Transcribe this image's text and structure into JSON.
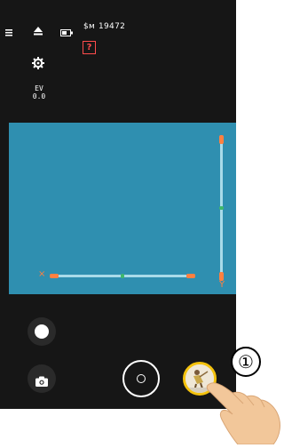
{
  "status_bar": {
    "menu_icon": "menu-icon",
    "eject_icon": "eject-icon",
    "battery_icon": "battery-icon",
    "storage_prefix": "$м",
    "storage_count": "19472",
    "warning_label": "?"
  },
  "settings": {
    "gear_icon": "gear-icon",
    "ev_label": "EV",
    "ev_value": "0.0"
  },
  "level": {
    "horizontal_marker": "×",
    "vertical_marker": "Y"
  },
  "controls": {
    "video_icon": "record-icon",
    "photo_icon": "camera-icon",
    "shutter_icon": "shutter-icon",
    "gallery_icon": "gallery-thumbnail"
  },
  "annotation": {
    "callout_label": "①",
    "hand_icon": "pointing-hand-icon"
  },
  "colors": {
    "viewfinder": "#2f8fb0",
    "level_bar": "#a9dbe9",
    "level_end": "#ff8040",
    "level_center": "#3fb96b",
    "warning": "#ff4c4c",
    "thumbnail_ring": "#f4c20d"
  }
}
